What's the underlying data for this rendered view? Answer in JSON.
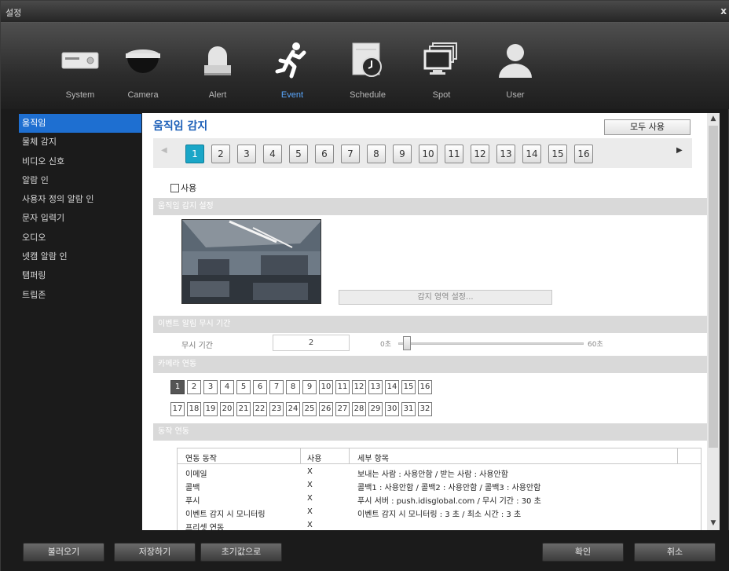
{
  "window": {
    "title": "설정",
    "close": "x"
  },
  "nav": [
    {
      "label": "System",
      "icon": "dvr-box-icon"
    },
    {
      "label": "Camera",
      "icon": "dome-camera-icon"
    },
    {
      "label": "Alert",
      "icon": "alarm-light-icon"
    },
    {
      "label": "Event",
      "icon": "running-person-icon"
    },
    {
      "label": "Schedule",
      "icon": "schedule-clock-icon"
    },
    {
      "label": "Spot",
      "icon": "monitors-icon"
    },
    {
      "label": "User",
      "icon": "user-silhouette-icon"
    }
  ],
  "sidebar": {
    "items": [
      {
        "label": "움직임"
      },
      {
        "label": "물체 감지"
      },
      {
        "label": "비디오 신호"
      },
      {
        "label": "알람 인"
      },
      {
        "label": "사용자 정의 알람 인"
      },
      {
        "label": "문자 입력기"
      },
      {
        "label": "오디오"
      },
      {
        "label": "넷캠 알람 인"
      },
      {
        "label": "탬퍼링"
      },
      {
        "label": "트립존"
      }
    ],
    "active_index": 0
  },
  "main": {
    "title": "움직임 감지",
    "all_use_button": "모두 사용",
    "pager": {
      "pages": [
        "1",
        "2",
        "3",
        "4",
        "5",
        "6",
        "7",
        "8",
        "9",
        "10",
        "11",
        "12",
        "13",
        "14",
        "15",
        "16"
      ],
      "active": "1"
    },
    "use_checkbox": {
      "label": "사용",
      "checked": false
    },
    "section_motion": "움직임 감지 설정",
    "detect_area_button": "감지 영역 설정...",
    "section_ignore": "이벤트 알림 무시 기간",
    "ignore": {
      "label": "무시 기간",
      "value": "2",
      "min_label": "0초",
      "max_label": "60초",
      "slider_fraction": 0.033
    },
    "section_camera": "카메라 연동",
    "cameras": {
      "row1": [
        "1",
        "2",
        "3",
        "4",
        "5",
        "6",
        "7",
        "8",
        "9",
        "10",
        "11",
        "12",
        "13",
        "14",
        "15",
        "16"
      ],
      "row2": [
        "17",
        "18",
        "19",
        "20",
        "21",
        "22",
        "23",
        "24",
        "25",
        "26",
        "27",
        "28",
        "29",
        "30",
        "31",
        "32"
      ],
      "active": "1"
    },
    "section_action": "동작 연동",
    "action_table": {
      "headers": [
        "연동 동작",
        "사용",
        "세부 항목"
      ],
      "rows": [
        [
          "이메일",
          "X",
          "보내는 사람 : 사용안함  /  받는 사람 : 사용안함"
        ],
        [
          "콜백",
          "X",
          "콜백1 : 사용안함 / 콜백2 : 사용안함 / 콜백3 : 사용안함"
        ],
        [
          "푸시",
          "X",
          "푸시 서버 : push.idisglobal.com / 무시 기간 : 30 초"
        ],
        [
          "이벤트 감지 시 모니터링",
          "X",
          "이벤트 감지 시 모니터링 : 3 초 / 최소 시간 : 3 초"
        ],
        [
          "프리셋 연동",
          "X",
          ""
        ]
      ]
    }
  },
  "footer": {
    "load": "불러오기",
    "save": "저장하기",
    "reset": "초기값으로",
    "ok": "확인",
    "cancel": "취소"
  },
  "colors": {
    "accent": "#1e6fd1",
    "page_active": "#1aa6c7",
    "event_active": "#5aa8ff",
    "heading": "#1c5fb8"
  }
}
